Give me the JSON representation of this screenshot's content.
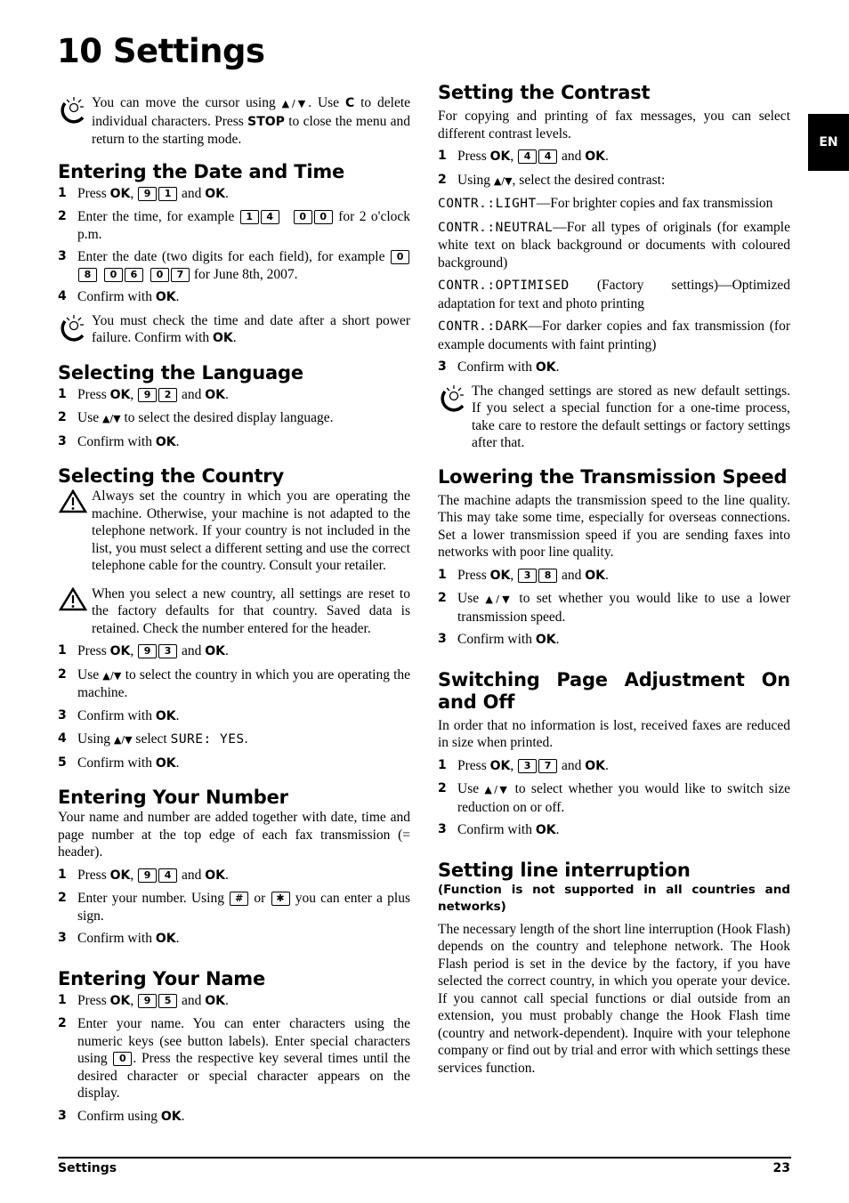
{
  "page": {
    "chapter_title": "10 Settings",
    "lang_tab": "EN",
    "footer_left": "Settings",
    "footer_right": "23"
  },
  "common": {
    "ok": "OK",
    "arrows": "▲/▼",
    "press": "Press",
    "and": "and",
    "confirm_with": "Confirm with",
    "comma": ",",
    "period": "."
  },
  "intro_tip": {
    "icon": "lightbulb-tip-icon",
    "t1": "You can move the cursor using",
    "t2": ". Use",
    "key_c": "C",
    "t3": "to delete individual characters. Press",
    "key_stop": "STOP",
    "t4": "to close the menu and return to the starting mode."
  },
  "date_time": {
    "heading": "Entering the Date and Time",
    "step1_keys": [
      "9",
      "1"
    ],
    "step2_text": "Enter the time, for example",
    "step2_keys_a": [
      "1",
      "4"
    ],
    "step2_keys_b": [
      "0",
      "0"
    ],
    "step2_tail": "for 2 o'clock p.m.",
    "step3_text": "Enter the date (two digits for each field), for example",
    "step3_keys": [
      [
        "0",
        "8"
      ],
      [
        "0",
        "6"
      ],
      [
        "0",
        "7"
      ]
    ],
    "step3_tail": "for June 8th, 2007.",
    "tip_text": "You must check the time and date after a short power failure. Confirm with"
  },
  "language": {
    "heading": "Selecting the Language",
    "step1_keys": [
      "9",
      "2"
    ],
    "step2_a": "Use",
    "step2_b": "to select the desired display language."
  },
  "country": {
    "heading": "Selecting the Country",
    "warning1": "Always set the country in which you are operating the machine. Otherwise, your machine is not adapted to the telephone network. If your country is not included in the list, you must select a different setting and use the correct telephone cable for the country. Consult your retailer.",
    "warning2": "When you select a new country, all settings are reset to the factory defaults for that country. Saved data is retained. Check the number entered for the header.",
    "step1_keys": [
      "9",
      "3"
    ],
    "step2_a": "Use",
    "step2_b": "to select the country in which you are operating the machine.",
    "step4_a": "Using",
    "step4_b": "select",
    "step4_lcd": "SURE: YES"
  },
  "number": {
    "heading": "Entering Your Number",
    "intro": "Your name and number are added together with date, time and page number at the top edge of each fax transmission (= header).",
    "step1_keys": [
      "9",
      "4"
    ],
    "step2_a": "Enter your number. Using",
    "key_hash": "#",
    "step2_or": "or",
    "key_star": "✱",
    "step2_b": "you can enter a plus sign."
  },
  "name": {
    "heading": "Entering Your Name",
    "step1_keys": [
      "9",
      "5"
    ],
    "step2_a": "Enter your name. You can enter characters using the numeric keys (see button labels). Enter special characters using",
    "key_zero": "0",
    "step2_b": ". Press the respective key several times until the desired character or special character appears on the display.",
    "step3": "Confirm using"
  },
  "contrast": {
    "heading": "Setting the Contrast",
    "intro": "For copying and printing of fax messages, you can select different contrast levels.",
    "step1_keys": [
      "4",
      "4"
    ],
    "step2_a": "Using",
    "step2_b": ", select the desired contrast:",
    "options": [
      {
        "lcd": "CONTR.:LIGHT",
        "desc": "—For brighter copies and fax transmission"
      },
      {
        "lcd": "CONTR.:NEUTRAL",
        "desc": "—For all types of originals (for example white text on black background or documents with coloured background)"
      },
      {
        "lcd": "CONTR.:OPTIMISED",
        "desc": " (Factory settings)—Optimized adaptation for text and photo printing"
      },
      {
        "lcd": "CONTR.:DARK",
        "desc": "—For darker copies and fax transmission (for example documents with faint printing)"
      }
    ],
    "tip_text": "The changed settings are stored as new default settings. If you select a special function for a one-time process, take care to restore the default settings or factory settings after that."
  },
  "speed": {
    "heading": "Lowering the Transmission Speed",
    "intro": "The machine adapts the transmission speed to the line quality. This may take some time, especially for overseas connections. Set a lower transmission speed if you are sending faxes into networks with poor line quality.",
    "step1_keys": [
      "3",
      "8"
    ],
    "step2_a": "Use",
    "step2_b": "to set whether you would like to use a lower transmission speed."
  },
  "page_adjust": {
    "heading": "Switching Page Adjustment On and Off",
    "intro": "In order that no information is lost, received faxes are reduced in size when printed.",
    "step1_keys": [
      "3",
      "7"
    ],
    "step2_a": "Use",
    "step2_b": "to select whether you would like to switch size reduction on or off."
  },
  "line_interrupt": {
    "heading": "Setting line interruption",
    "subheading": "(Function is not supported in all countries and networks)",
    "body": "The necessary length of the short line interruption (Hook Flash) depends on the country and telephone network. The Hook Flash period is set in the device by the factory, if you have selected the correct country, in which you operate your device. If you cannot call special functions or dial outside from an extension, you must probably change the Hook Flash time (country and network-dependent). Inquire with your telephone company or find out by trial and error with which settings these services function."
  }
}
